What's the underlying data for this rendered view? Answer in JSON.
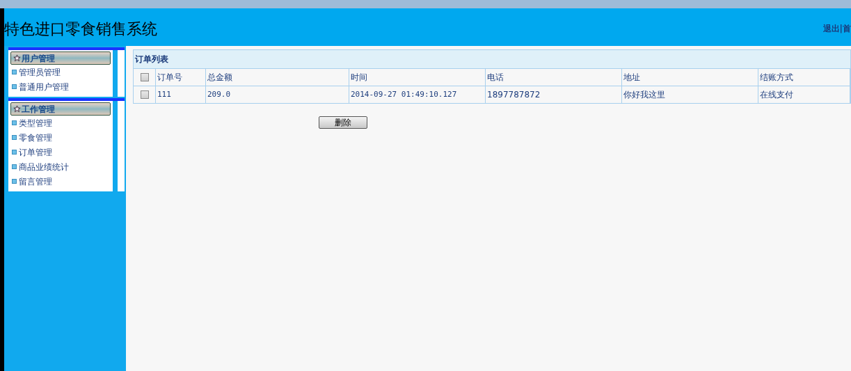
{
  "header": {
    "title": "特色进口零食销售系统",
    "links": [
      "退出",
      "|",
      "首"
    ]
  },
  "sidebar": {
    "groups": [
      {
        "title": "用户管理",
        "items": [
          "管理员管理",
          "普通用户管理"
        ]
      },
      {
        "title": "工作管理",
        "items": [
          "类型管理",
          "零食管理",
          "订单管理",
          "商品业绩统计",
          "留言管理"
        ]
      }
    ]
  },
  "panel": {
    "title": "订单列表",
    "table": {
      "select_all": {
        "checked": false
      },
      "columns": [
        "订单号",
        "总金额",
        "时间",
        "电话",
        "地址",
        "结账方式"
      ],
      "rows": [
        {
          "checked": false,
          "cells": [
            "111",
            "209.0",
            "2014-09-27 01:49:10.127",
            "1897787872",
            "你好我这里",
            "在线支付"
          ]
        }
      ]
    },
    "delete_button": "删除"
  }
}
